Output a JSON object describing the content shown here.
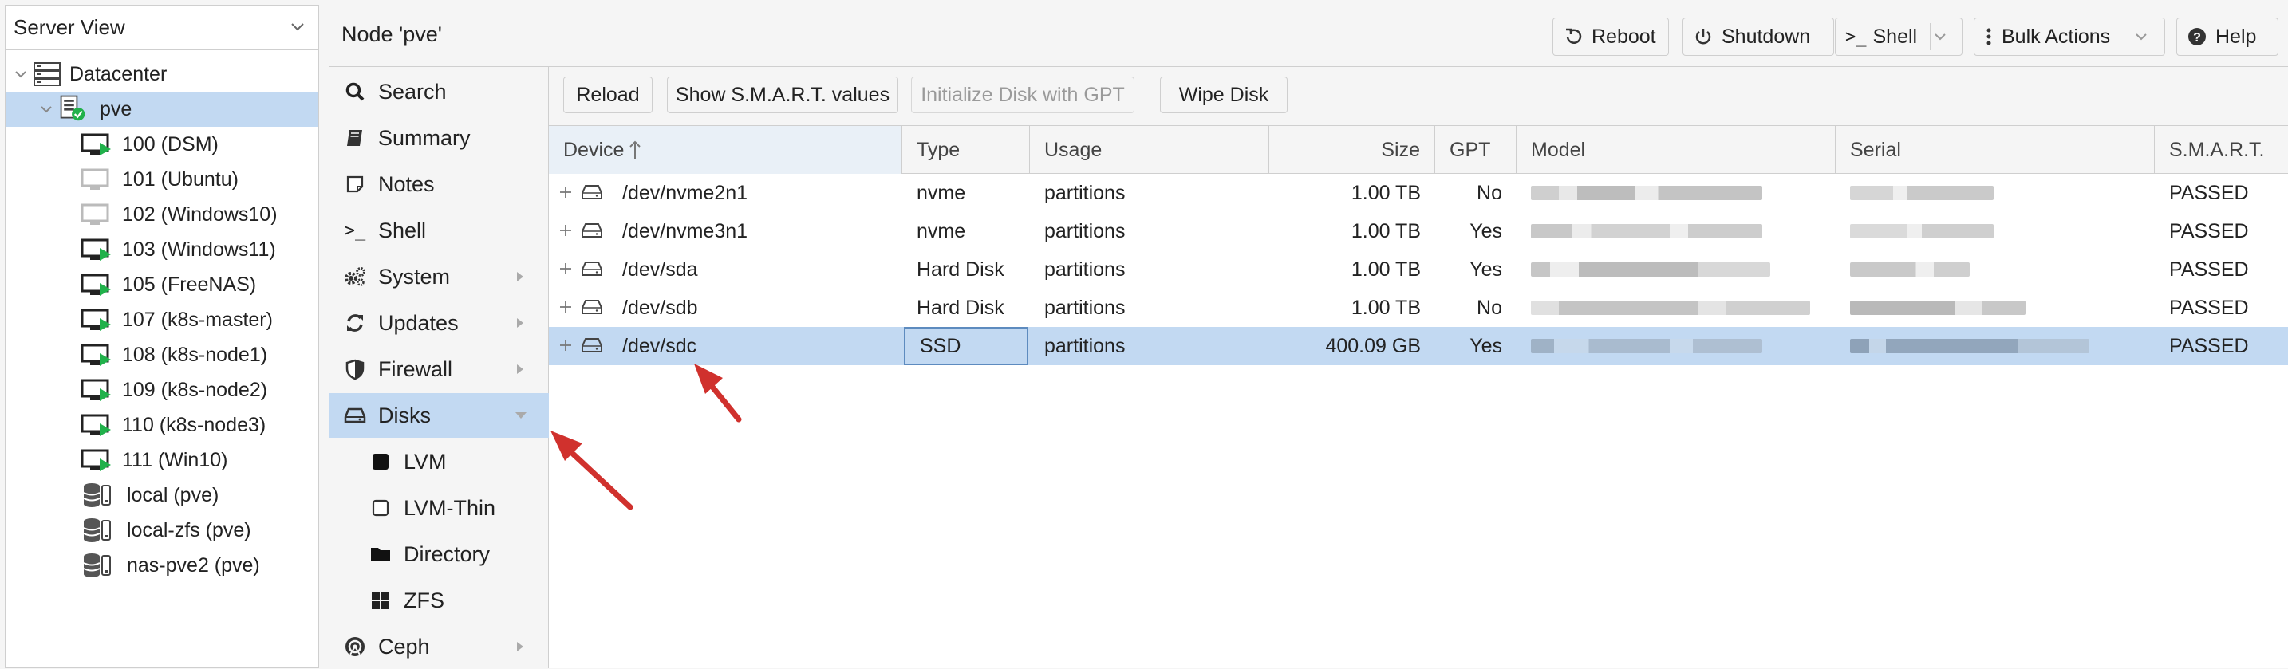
{
  "view_selector": {
    "label": "Server View"
  },
  "tree": {
    "datacenter": "Datacenter",
    "node": "pve",
    "guests": [
      {
        "label": "100 (DSM)",
        "running": true
      },
      {
        "label": "101 (Ubuntu)",
        "running": false
      },
      {
        "label": "102 (Windows10)",
        "running": false
      },
      {
        "label": "103 (Windows11)",
        "running": true
      },
      {
        "label": "105 (FreeNAS)",
        "running": true
      },
      {
        "label": "107 (k8s-master)",
        "running": true
      },
      {
        "label": "108 (k8s-node1)",
        "running": true
      },
      {
        "label": "109 (k8s-node2)",
        "running": true
      },
      {
        "label": "110 (k8s-node3)",
        "running": true
      },
      {
        "label": "111 (Win10)",
        "running": true
      }
    ],
    "storages": [
      {
        "label": "local (pve)"
      },
      {
        "label": "local-zfs (pve)"
      },
      {
        "label": "nas-pve2 (pve)"
      }
    ]
  },
  "header": {
    "title": "Node 'pve'",
    "buttons": {
      "reboot": "Reboot",
      "shutdown": "Shutdown",
      "shell": "Shell",
      "bulk_actions": "Bulk Actions",
      "help": "Help"
    }
  },
  "nav": {
    "search": "Search",
    "summary": "Summary",
    "notes": "Notes",
    "shell": "Shell",
    "system": "System",
    "updates": "Updates",
    "firewall": "Firewall",
    "disks": "Disks",
    "lvm": "LVM",
    "lvm_thin": "LVM-Thin",
    "directory": "Directory",
    "zfs": "ZFS",
    "ceph": "Ceph"
  },
  "toolbar": {
    "reload": "Reload",
    "smart": "Show S.M.A.R.T. values",
    "init_gpt": "Initialize Disk with GPT",
    "wipe": "Wipe Disk"
  },
  "grid": {
    "columns": {
      "device": "Device",
      "type": "Type",
      "usage": "Usage",
      "size": "Size",
      "gpt": "GPT",
      "model": "Model",
      "serial": "Serial",
      "smart": "S.M.A.R.T."
    },
    "rows": [
      {
        "device": "/dev/nvme2n1",
        "type": "nvme",
        "usage": "partitions",
        "size": "1.00 TB",
        "gpt": "No",
        "smart": "PASSED",
        "selected": false
      },
      {
        "device": "/dev/nvme3n1",
        "type": "nvme",
        "usage": "partitions",
        "size": "1.00 TB",
        "gpt": "Yes",
        "smart": "PASSED",
        "selected": false
      },
      {
        "device": "/dev/sda",
        "type": "Hard Disk",
        "usage": "partitions",
        "size": "1.00 TB",
        "gpt": "Yes",
        "smart": "PASSED",
        "selected": false
      },
      {
        "device": "/dev/sdb",
        "type": "Hard Disk",
        "usage": "partitions",
        "size": "1.00 TB",
        "gpt": "No",
        "smart": "PASSED",
        "selected": false
      },
      {
        "device": "/dev/sdc",
        "type": "SSD",
        "usage": "partitions",
        "size": "400.09 GB",
        "gpt": "Yes",
        "smart": "PASSED",
        "selected": true
      }
    ]
  },
  "colors": {
    "selection": "#c2d9f2",
    "running_badge": "#21b14b",
    "annotation_arrow": "#d0312d",
    "panel_bg": "#f5f5f5"
  }
}
